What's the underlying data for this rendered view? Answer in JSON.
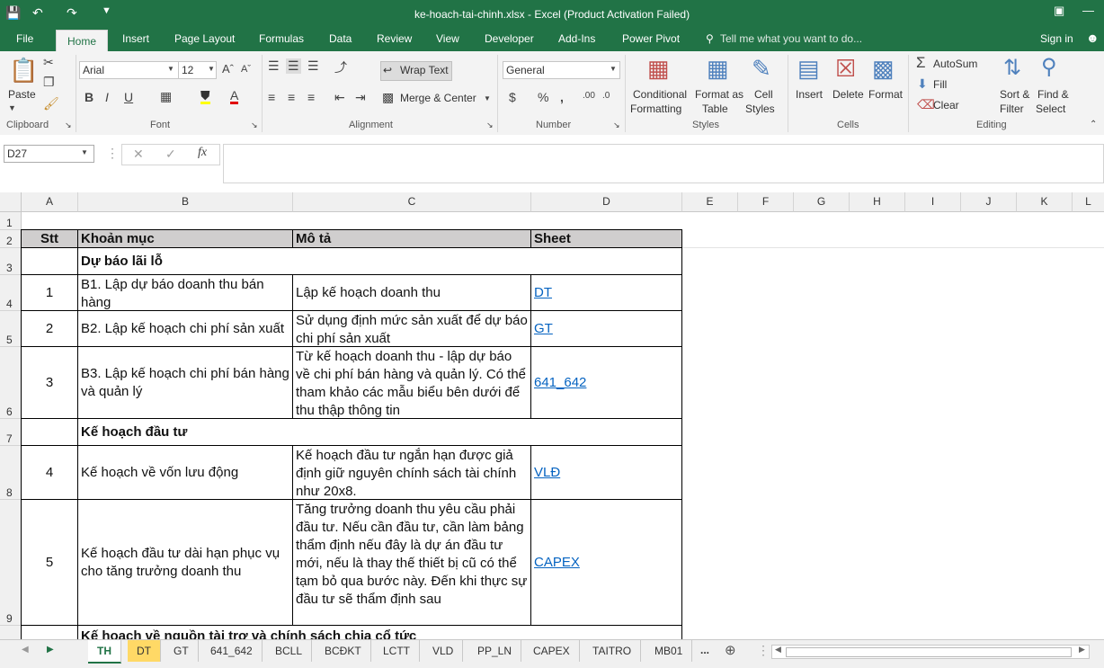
{
  "window": {
    "title": "ke-hoach-tai-chinh.xlsx - Excel (Product Activation Failed)"
  },
  "ribbon_tabs": [
    "File",
    "Home",
    "Insert",
    "Page Layout",
    "Formulas",
    "Data",
    "Review",
    "View",
    "Developer",
    "Add-Ins",
    "Power Pivot"
  ],
  "tell_me": "Tell me what you want to do...",
  "sign_in": "Sign in",
  "clipboard": {
    "paste": "Paste",
    "label": "Clipboard"
  },
  "font": {
    "name": "Arial",
    "size": "12",
    "label": "Font"
  },
  "alignment": {
    "wrap": "Wrap Text",
    "merge": "Merge & Center",
    "label": "Alignment"
  },
  "number": {
    "format": "General",
    "label": "Number"
  },
  "styles": {
    "conditional": "Conditional",
    "formatting": "Formatting",
    "format_as": "Format as",
    "table": "Table",
    "cell": "Cell",
    "styles_word": "Styles",
    "label": "Styles"
  },
  "cells": {
    "insert": "Insert",
    "delete": "Delete",
    "format": "Format",
    "label": "Cells"
  },
  "editing": {
    "autosum": "AutoSum",
    "fill": "Fill",
    "clear": "Clear",
    "sort": "Sort &",
    "filter": "Filter",
    "find": "Find &",
    "select": "Select",
    "label": "Editing"
  },
  "name_box": "D27",
  "columns": [
    "A",
    "B",
    "C",
    "D",
    "E",
    "F",
    "G",
    "H",
    "I",
    "J",
    "K",
    "L"
  ],
  "rows": [
    "1",
    "2",
    "3",
    "4",
    "5",
    "6",
    "7",
    "8",
    "9"
  ],
  "sheet": {
    "header": {
      "stt": "Stt",
      "item": "Khoản mục",
      "desc": "Mô tả",
      "sheet": "Sheet"
    },
    "section1": "Dự báo lãi lỗ",
    "r4": {
      "stt": "1",
      "item": "B1. Lập dự báo doanh thu bán hàng",
      "desc": "Lập kế hoạch doanh thu",
      "link": "DT"
    },
    "r5": {
      "stt": "2",
      "item": "B2. Lập kế hoạch chi phí sản xuất",
      "desc": "Sử dụng định mức sản xuất để dự báo chi phí sản xuất",
      "link": "GT"
    },
    "r6": {
      "stt": "3",
      "item": "B3. Lập kế hoạch chi phí bán hàng và quản lý",
      "desc": "Từ kế hoạch doanh thu - lập dự báo về chi phí bán hàng và quản lý. Có thể tham khảo các mẫu biểu bên dưới để thu thập thông tin",
      "link": "641_642"
    },
    "section2": "Kế hoạch đầu tư",
    "r8": {
      "stt": "4",
      "item": "Kế hoạch về vốn lưu động",
      "desc": "Kế hoạch đầu tư ngắn hạn được giả định giữ nguyên chính sách tài chính như 20x8.",
      "link": "VLĐ"
    },
    "r9": {
      "stt": "5",
      "item": "Kế hoạch đầu tư dài hạn phục vụ cho tăng trưởng doanh thu",
      "desc": "Tăng trưởng doanh thu yêu cầu phải đầu tư. Nếu cần đầu tư, cần làm bảng thẩm định nếu đây là dự án đầu tư mới, nếu là thay thế thiết bị cũ có thể tạm bỏ qua bước này. Đến khi thực sự đầu tư sẽ thẩm định sau",
      "link": "CAPEX"
    },
    "section3_partial": "Kế hoạch về nguồn tài trợ và chính sách chia cổ tức"
  },
  "sheet_tabs": [
    "TH",
    "DT",
    "GT",
    "641_642",
    "BCLL",
    "BCĐKT",
    "LCTT",
    "VLD",
    "PP_LN",
    "CAPEX",
    "TAITRO",
    "MB01"
  ],
  "ellipsis": "..."
}
